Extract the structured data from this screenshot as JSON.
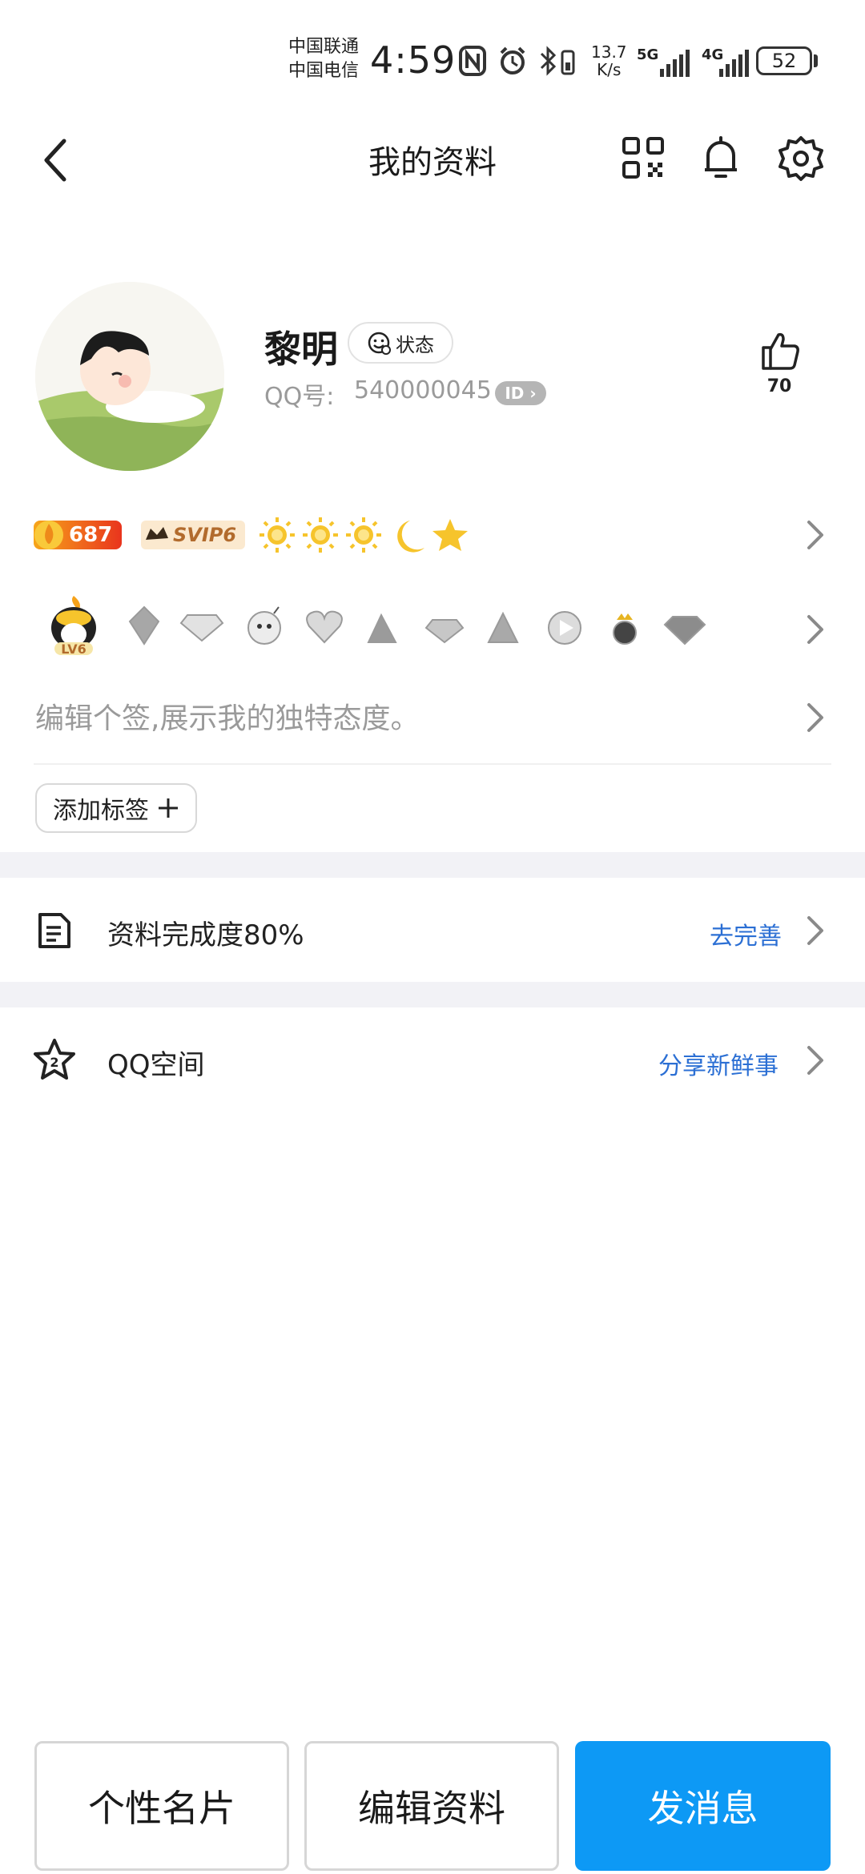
{
  "status_bar": {
    "carrier1": "中国联通",
    "carrier2": "中国电信",
    "time": "4:59",
    "net_speed_value": "13.7",
    "net_speed_unit": "K/s",
    "signal1": "5G",
    "signal2": "4G",
    "battery": "52"
  },
  "header": {
    "title": "我的资料",
    "icons": [
      "back-arrow-icon",
      "qr-code-icon",
      "bell-icon",
      "gear-icon"
    ]
  },
  "profile": {
    "name": "黎明",
    "status_label": "状态",
    "qq_label": "QQ号:",
    "qq_number": "540000045",
    "id_badge": "ID",
    "likes": "70"
  },
  "badges": {
    "level_value": "687",
    "svip": "SVIP6",
    "level_suns": 3,
    "level_moons": 1,
    "level_stars": 1,
    "medal_level": "LV6"
  },
  "signature": {
    "placeholder": "编辑个签,展示我的独特态度。"
  },
  "tags": {
    "add_label": "添加标签"
  },
  "rows": {
    "completion_label": "资料完成度80%",
    "completion_link": "去完善",
    "qzone_label": "QQ空间",
    "qzone_link": "分享新鲜事"
  },
  "bottom": {
    "card_button": "个性名片",
    "edit_button": "编辑资料",
    "message_button": "发消息"
  },
  "colors": {
    "accent": "#0d99f5",
    "link": "#2b6fd4",
    "band": "#f2f2f6"
  }
}
